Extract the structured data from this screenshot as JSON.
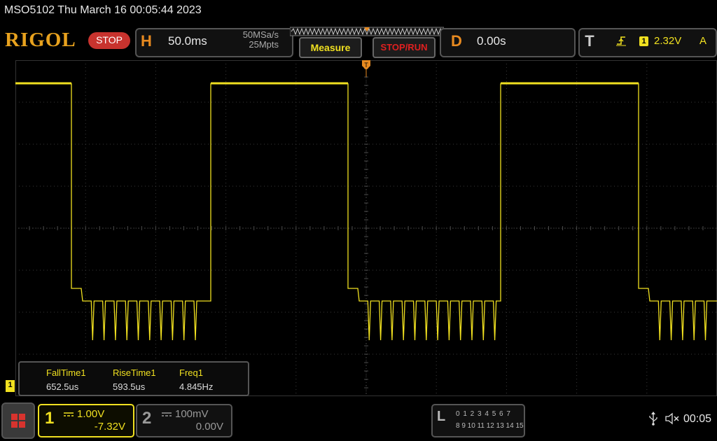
{
  "title_bar": {
    "text": "MSO5102  Thu March 16 00:05:44 2023"
  },
  "brand": {
    "logo": "RIGOL",
    "status": "STOP"
  },
  "horizontal": {
    "tag": "H",
    "timebase": "50.0ms",
    "sample_rate": "50MSa/s",
    "memory_depth": "25Mpts"
  },
  "buttons": {
    "measure": "Measure",
    "stop_run": "STOP/RUN"
  },
  "delay": {
    "tag": "D",
    "value": "0.00s"
  },
  "trigger": {
    "tag": "T",
    "edge_icon": "rising-edge-icon",
    "source": "1",
    "level": "2.32V",
    "mode": "A"
  },
  "measurements": [
    {
      "label": "FallTime1",
      "value": "652.5us"
    },
    {
      "label": "RiseTime1",
      "value": "593.5us"
    },
    {
      "label": "Freq1",
      "value": "4.845Hz"
    }
  ],
  "ch1_marker": "1",
  "channel1": {
    "number": "1",
    "scale": "1.00V",
    "offset": "-7.32V",
    "color": "#f0e020"
  },
  "channel2": {
    "number": "2",
    "scale": "100mV",
    "offset": "0.00V",
    "color": "#999999"
  },
  "logic_analyzer": {
    "tag": "L",
    "row1": "0 1 2 3  4 5 6 7",
    "row2": "8 9 10 11 12 13 14 15"
  },
  "status_area": {
    "usb_icon": "usb-icon",
    "speaker_icon": "speaker-muted-icon",
    "time": "00:05"
  }
}
